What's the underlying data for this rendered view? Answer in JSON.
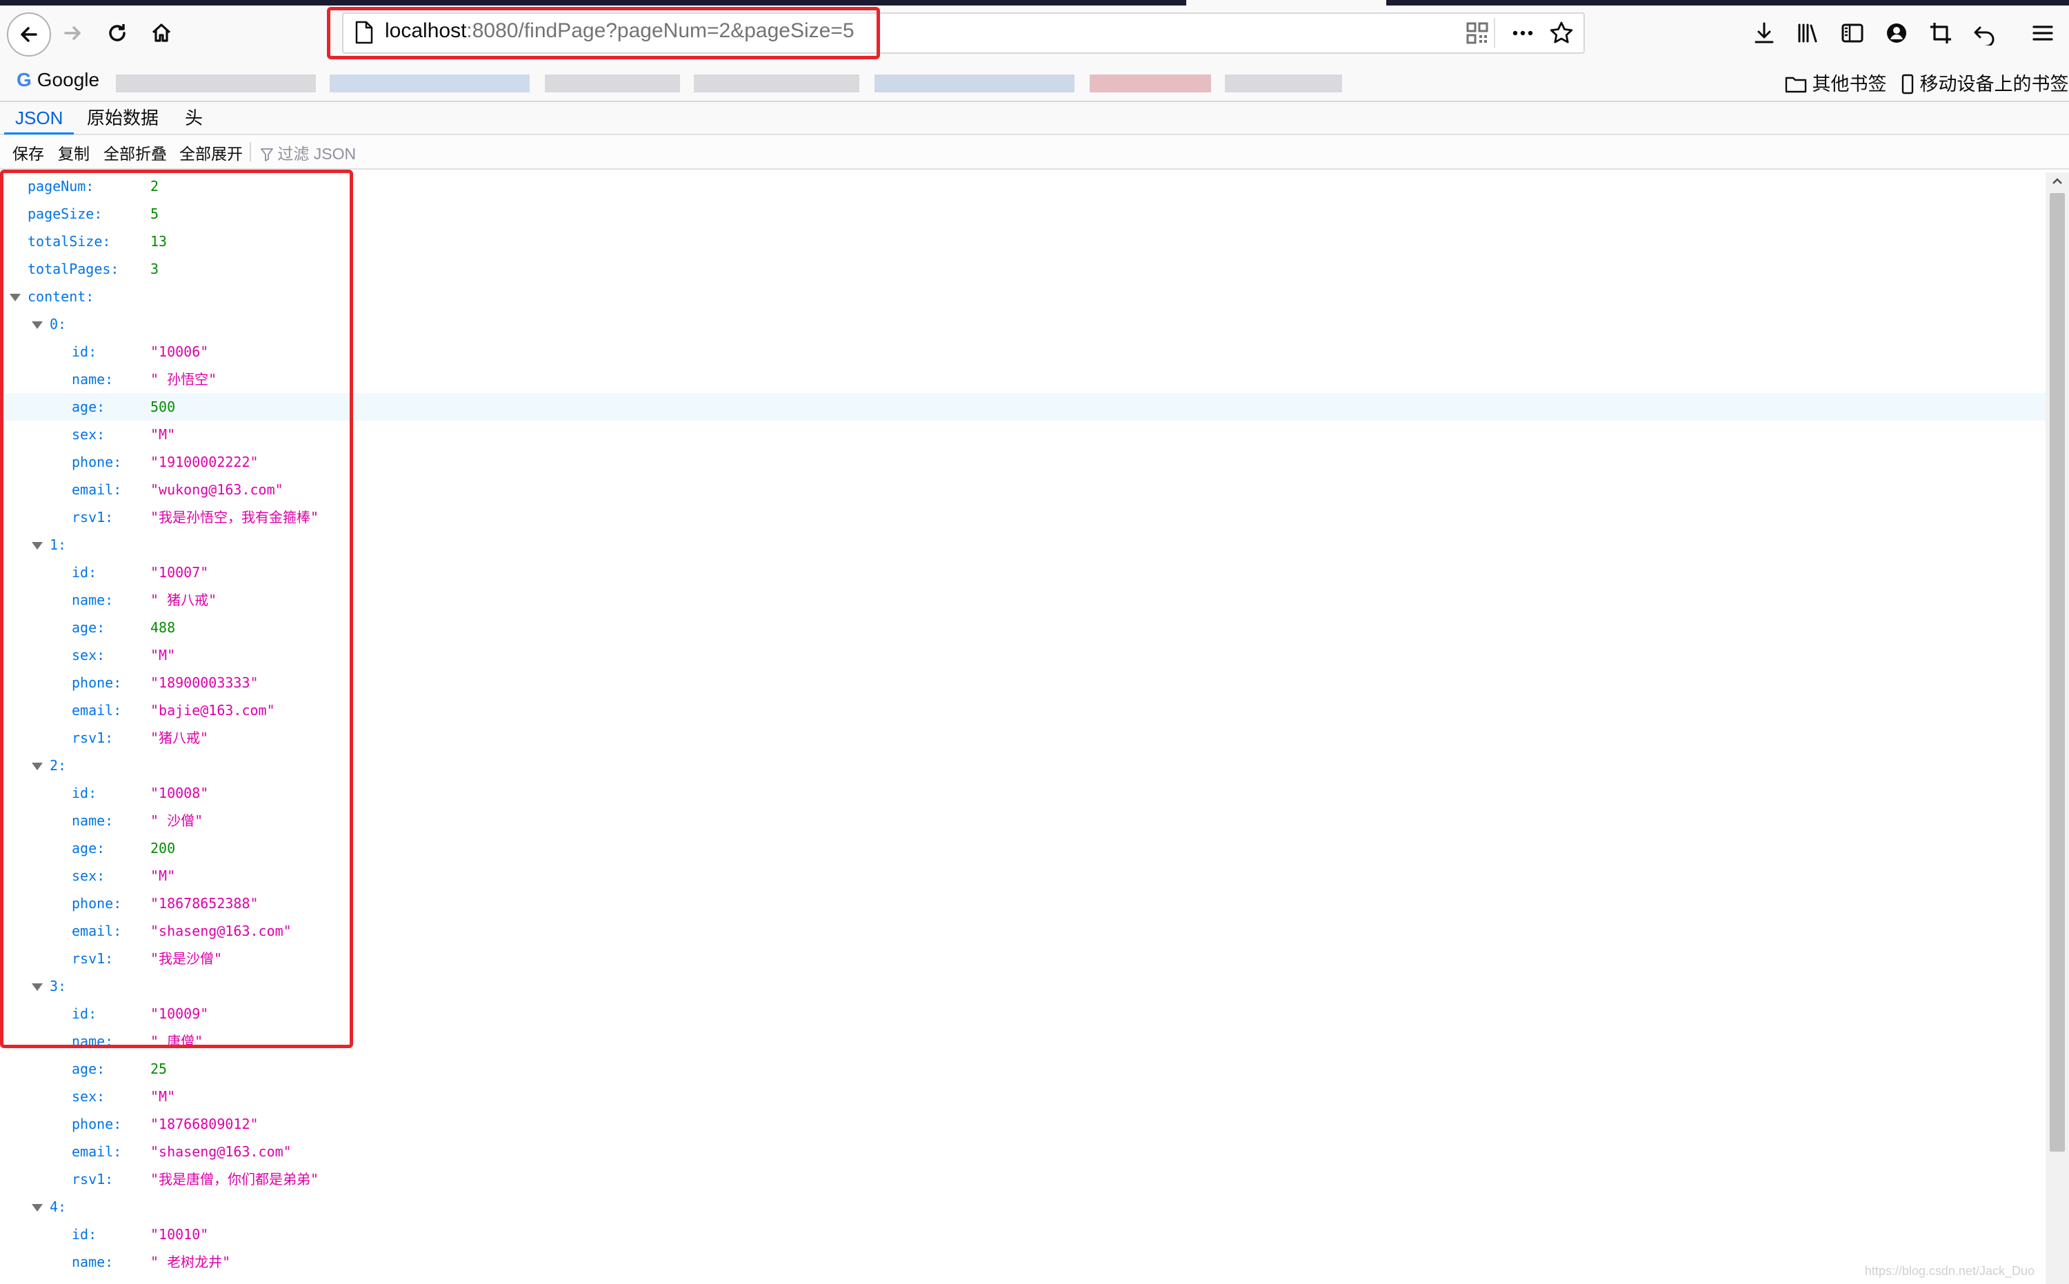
{
  "browser": {
    "url_host": "localhost",
    "url_rest": ":8080/findPage?pageNum=2&pageSize=5",
    "google_bookmark": "Google",
    "other_bookmarks": "其他书签",
    "mobile_bookmarks": "移动设备上的书签"
  },
  "viewer": {
    "tabs": [
      "JSON",
      "原始数据",
      "头"
    ],
    "toolbar": {
      "save": "保存",
      "copy": "复制",
      "collapse_all": "全部折叠",
      "expand_all": "全部展开",
      "filter_placeholder": "过滤 JSON"
    }
  },
  "json_rows": [
    {
      "key": "pageNum:",
      "value": "2"
    },
    {
      "key": "pageSize:",
      "value": "5"
    },
    {
      "key": "totalSize:",
      "value": "13"
    },
    {
      "key": "totalPages:",
      "value": "3"
    },
    {
      "key": "content:"
    },
    {
      "key": "0:"
    },
    {
      "key": "id:",
      "value": "\"10006\""
    },
    {
      "key": "name:",
      "value": "\" 孙悟空\""
    },
    {
      "key": "age:",
      "value": "500"
    },
    {
      "key": "sex:",
      "value": "\"M\""
    },
    {
      "key": "phone:",
      "value": "\"19100002222\""
    },
    {
      "key": "email:",
      "value": "\"wukong@163.com\""
    },
    {
      "key": "rsv1:",
      "value": "\"我是孙悟空，我有金箍棒\""
    },
    {
      "key": "1:"
    },
    {
      "key": "id:",
      "value": "\"10007\""
    },
    {
      "key": "name:",
      "value": "\" 猪八戒\""
    },
    {
      "key": "age:",
      "value": "488"
    },
    {
      "key": "sex:",
      "value": "\"M\""
    },
    {
      "key": "phone:",
      "value": "\"18900003333\""
    },
    {
      "key": "email:",
      "value": "\"bajie@163.com\""
    },
    {
      "key": "rsv1:",
      "value": "\"猪八戒\""
    },
    {
      "key": "2:"
    },
    {
      "key": "id:",
      "value": "\"10008\""
    },
    {
      "key": "name:",
      "value": "\" 沙僧\""
    },
    {
      "key": "age:",
      "value": "200"
    },
    {
      "key": "sex:",
      "value": "\"M\""
    },
    {
      "key": "phone:",
      "value": "\"18678652388\""
    },
    {
      "key": "email:",
      "value": "\"shaseng@163.com\""
    },
    {
      "key": "rsv1:",
      "value": "\"我是沙僧\""
    },
    {
      "key": "3:"
    },
    {
      "key": "id:",
      "value": "\"10009\""
    },
    {
      "key": "name:",
      "value": "\" 唐僧\""
    },
    {
      "key": "age:",
      "value": "25"
    },
    {
      "key": "sex:",
      "value": "\"M\""
    },
    {
      "key": "phone:",
      "value": "\"18766809012\""
    },
    {
      "key": "email:",
      "value": "\"shaseng@163.com\""
    },
    {
      "key": "rsv1:",
      "value": "\"我是唐僧，你们都是弟弟\""
    },
    {
      "key": "4:"
    },
    {
      "key": "id:",
      "value": "\"10010\""
    },
    {
      "key": "name:",
      "value": "\" 老树龙井\""
    }
  ]
}
